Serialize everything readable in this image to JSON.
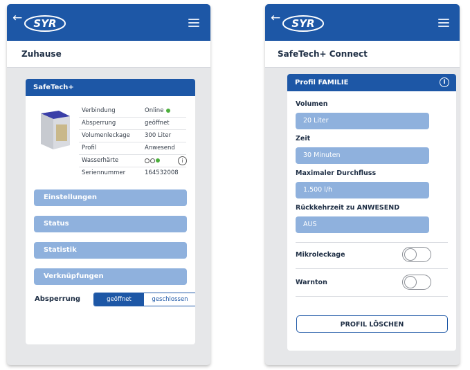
{
  "brand": "SYR",
  "left": {
    "header_title": "Zuhause",
    "card_title": "SafeTech+",
    "info": [
      {
        "key": "Verbindung",
        "value": "Online"
      },
      {
        "key": "Absperrung",
        "value": "geöffnet"
      },
      {
        "key": "Volumenleckage",
        "value": "300 Liter"
      },
      {
        "key": "Profil",
        "value": "Anwesend"
      },
      {
        "key": "Wasserhärte",
        "value": ""
      },
      {
        "key": "Seriennummer",
        "value": "164532008"
      }
    ],
    "menu": [
      "Einstellungen",
      "Status",
      "Statistik",
      "Verknüpfungen"
    ],
    "absperrung_label": "Absperrung",
    "segment": {
      "open": "geöffnet",
      "closed": "geschlossen",
      "selected": "geöffnet"
    }
  },
  "right": {
    "header_title": "SafeTech+ Connect",
    "card_title": "Profil FAMILIE",
    "fields": [
      {
        "label": "Volumen",
        "value": "20 Liter"
      },
      {
        "label": "Zeit",
        "value": "30 Minuten"
      },
      {
        "label": "Maximaler Durchfluss",
        "value": "1.500 l/h"
      },
      {
        "label": "Rückkehrzeit zu ANWESEND",
        "value": "AUS"
      }
    ],
    "toggles": [
      {
        "label": "Mikroleckage",
        "on": false
      },
      {
        "label": "Warnton",
        "on": false
      }
    ],
    "delete_button": "PROFIL LÖSCHEN"
  },
  "colors": {
    "primary": "#1d57a6",
    "pill": "#8fb1dd",
    "status_green": "#4caf3c"
  }
}
